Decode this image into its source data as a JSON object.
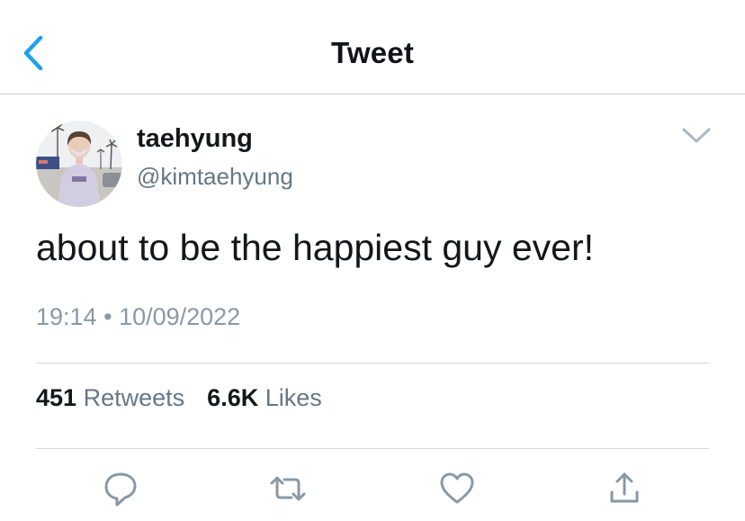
{
  "header": {
    "title": "Tweet",
    "back_icon": "chevron-left-icon"
  },
  "author": {
    "display_name": "taehyung",
    "handle": "@kimtaehyung",
    "avatar": "profile photo"
  },
  "tweet": {
    "text": "about to be the happiest guy ever!",
    "time": "19:14",
    "separator": "•",
    "date": "10/09/2022"
  },
  "stats": {
    "retweets_count": "451",
    "retweets_label": "Retweets",
    "likes_count": "6.6K",
    "likes_label": "Likes"
  },
  "actions": {
    "reply_icon": "reply-icon",
    "retweet_icon": "retweet-icon",
    "like_icon": "heart-icon",
    "share_icon": "share-icon"
  },
  "colors": {
    "accent": "#1DA1F2",
    "text_primary": "#14171A",
    "text_secondary": "#657786",
    "divider": "#D6D9DC"
  }
}
